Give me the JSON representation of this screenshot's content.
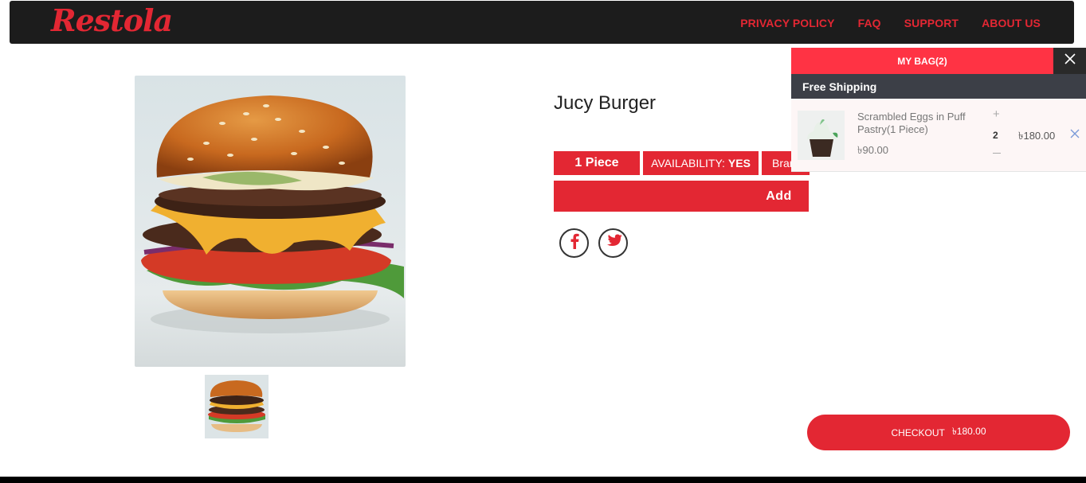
{
  "header": {
    "logo": "Restola",
    "nav": [
      "PRIVACY POLICY",
      "FAQ",
      "SUPPORT",
      "ABOUT US"
    ]
  },
  "product": {
    "title": "Jucy Burger",
    "piece_tag": "1 Piece",
    "availability_label": "AVAILABILITY:",
    "availability_value": "YES",
    "brand_tag": "Bran",
    "add_button": "Add"
  },
  "social": [
    "facebook-icon",
    "twitter-icon"
  ],
  "bag": {
    "title": "MY BAG(2)",
    "shipping": "Free Shipping",
    "items": [
      {
        "name": "Scrambled Eggs in Puff Pastry(1 Piece)",
        "unit_price": "৳90.00",
        "quantity": "2",
        "total": "৳180.00"
      }
    ],
    "checkout_label": "CHECKOUT",
    "checkout_total": "৳180.00"
  },
  "colors": {
    "brand_red": "#e32733",
    "header_bg": "#1c1c1c",
    "bag_header": "#ff3344",
    "shipping_bar": "#3c3f47"
  }
}
